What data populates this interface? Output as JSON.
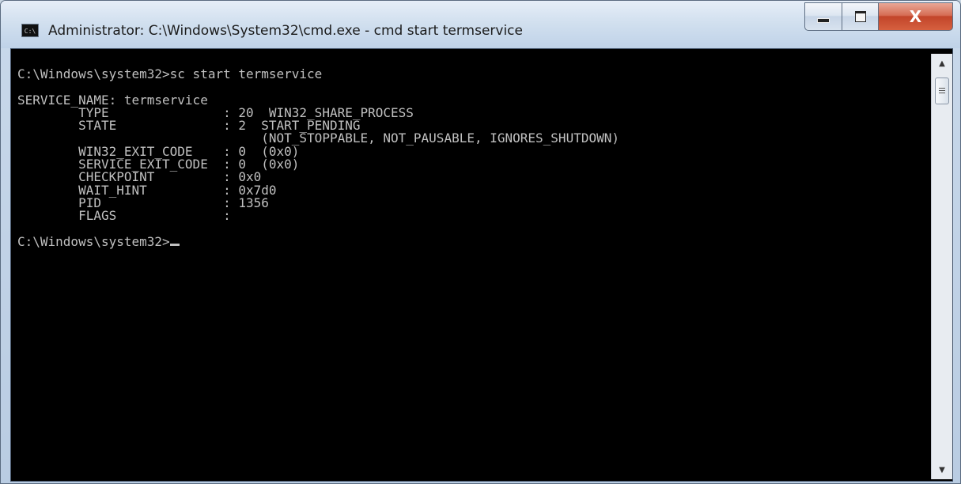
{
  "window": {
    "title": "Administrator: C:\\Windows\\System32\\cmd.exe - cmd  start termservice",
    "app_icon_label": "C:\\"
  },
  "caption": {
    "minimize_icon": "minimize-icon",
    "maximize_icon": "maximize-icon",
    "close_label": "X"
  },
  "console": {
    "lines": [
      "C:\\Windows\\system32>sc start termservice",
      "",
      "SERVICE_NAME: termservice",
      "        TYPE               : 20  WIN32_SHARE_PROCESS",
      "        STATE              : 2  START_PENDING",
      "                                (NOT_STOPPABLE, NOT_PAUSABLE, IGNORES_SHUTDOWN)",
      "        WIN32_EXIT_CODE    : 0  (0x0)",
      "        SERVICE_EXIT_CODE  : 0  (0x0)",
      "        CHECKPOINT         : 0x0",
      "        WAIT_HINT          : 0x7d0",
      "        PID                : 1356",
      "        FLAGS              :",
      ""
    ],
    "prompt": "C:\\Windows\\system32>"
  },
  "scrollbar": {
    "up_icon": "scroll-up-arrow-icon",
    "down_icon": "scroll-down-arrow-icon"
  },
  "colors": {
    "console_bg": "#000000",
    "console_fg": "#c0c0c0",
    "close_button": "#c2452a"
  }
}
